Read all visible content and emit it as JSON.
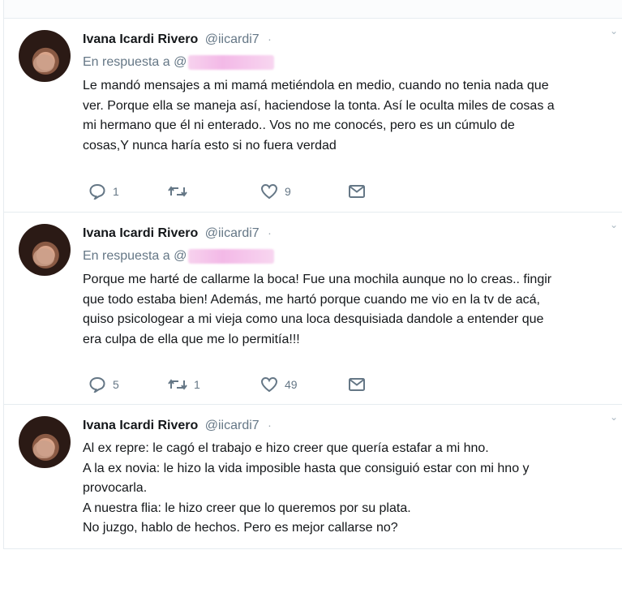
{
  "tweets": [
    {
      "author_name": "Ivana Icardi Rivero",
      "handle": "@iicardi7",
      "reply_prefix": "En respuesta a",
      "reply_handle": "@",
      "lines": [
        "Le mandó mensajes a mi mamá metiéndola en medio, cuando no tenia nada que",
        "ver. Porque ella se maneja así, haciendose la tonta. Así le oculta miles de cosas a",
        "mi hermano que él ni enterado.. Vos no me conocés, pero es un cúmulo de",
        "cosas,Y nunca haría esto si no fuera verdad"
      ],
      "replies": "1",
      "retweets": "",
      "likes": "9"
    },
    {
      "author_name": "Ivana Icardi Rivero",
      "handle": "@iicardi7",
      "reply_prefix": "En respuesta a",
      "reply_handle": "@",
      "lines": [
        "Porque me harté de callarme la boca! Fue una mochila aunque no lo creas.. fingir",
        "que todo estaba bien! Además, me hartó porque cuando me vio en la tv de acá,",
        "quiso psicologear a mi vieja como una loca desquisiada dandole a entender que",
        "era culpa de ella que me lo permitía!!!"
      ],
      "replies": "5",
      "retweets": "1",
      "likes": "49"
    },
    {
      "author_name": "Ivana Icardi Rivero",
      "handle": "@iicardi7",
      "lines": [
        "Al ex repre: le cagó el trabajo e hizo creer que quería estafar a mi hno.",
        "A la ex novia: le hizo la vida imposible hasta que consiguió estar con mi hno y",
        "provocarla.",
        "A nuestra flia: le hizo creer que lo queremos por su plata.",
        "No juzgo, hablo de hechos. Pero es mejor callarse no?"
      ]
    }
  ],
  "icons": {
    "reply": "reply-bubble-icon",
    "retweet": "retweet-icon",
    "like": "heart-icon",
    "dm": "envelope-icon",
    "caret": "chevron-down-icon"
  },
  "colors": {
    "text": "#14171a",
    "secondary": "#657786",
    "divider": "#e6ecf0",
    "blur_mask": "#f3b9e7"
  }
}
